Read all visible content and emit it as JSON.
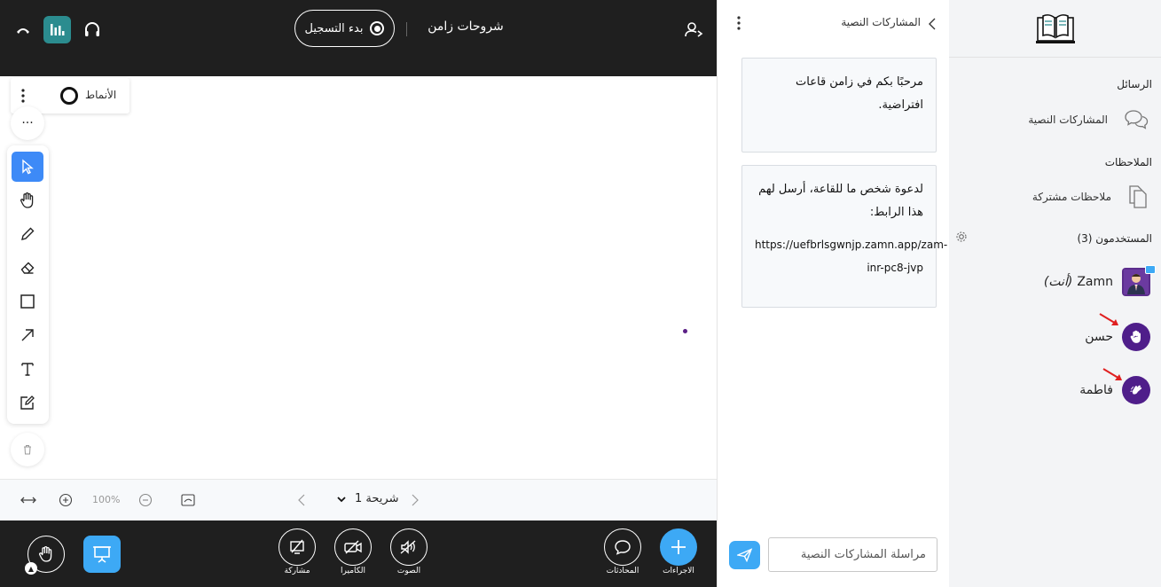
{
  "topbar": {
    "record_label": "بدء التسجيل",
    "presentation_title": "شروحات زامن"
  },
  "styles_popover": {
    "label": "الأنماط"
  },
  "tools": {
    "more_label": "···",
    "items": [
      "select",
      "hand",
      "pencil",
      "eraser",
      "rectangle",
      "arrow",
      "text",
      "note"
    ],
    "active": "select"
  },
  "slidebar": {
    "zoom_level": "100%",
    "slide_label": "شريحة 1"
  },
  "bottombar": {
    "share_label": "مشاركة",
    "camera_label": "الكاميرا",
    "audio_label": "الصوت",
    "chats_label": "المحادثات",
    "actions_label": "الاجراءات"
  },
  "chat": {
    "title": "المشاركات النصية",
    "messages": [
      {
        "text": "مرحبًا بكم في زامن قاعات افتراضية."
      },
      {
        "text": "لدعوة شخص ما للقاعة، أرسل لهم هذا الرابط:",
        "link": "https://uefbrlsgwnjp.zamn.app/zam-inr-pc8-jvp"
      }
    ],
    "input_placeholder": "مراسلة المشاركات النصية"
  },
  "sidebar": {
    "messages_section": "الرسائل",
    "messages_item": "المشاركات النصية",
    "notes_section": "الملاحظات",
    "notes_item": "ملاحظات مشتركة",
    "users_section": "المستخدمون (3)",
    "users": [
      {
        "name": "Zamn",
        "suffix": "(أنت)"
      },
      {
        "name": "حسن"
      },
      {
        "name": "فاطمة"
      }
    ]
  },
  "colors": {
    "dark_bar": "#1f1f1f",
    "accent_blue": "#3da9f5",
    "avatar_purple": "#4f1e8a",
    "teal": "#2b8c8f"
  }
}
